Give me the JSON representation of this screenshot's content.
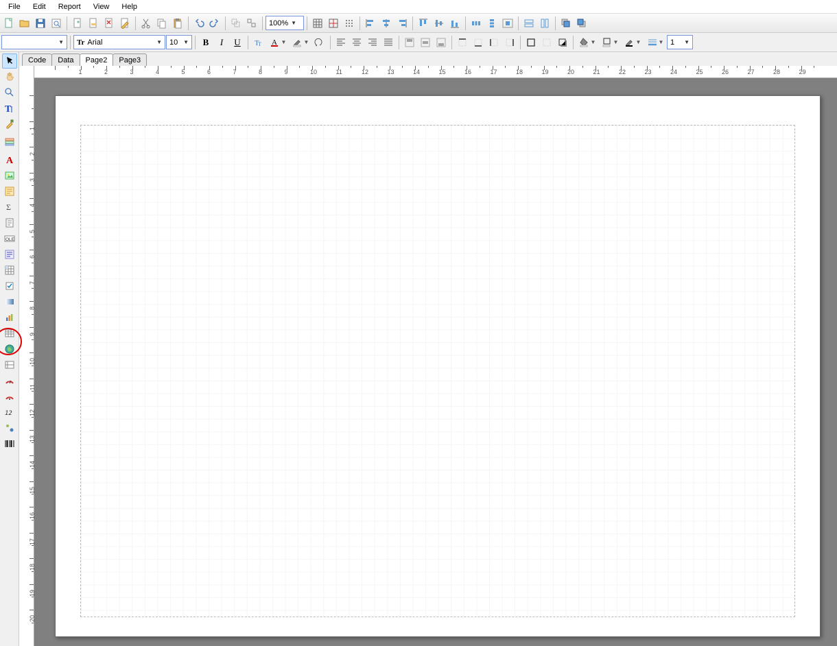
{
  "menus": [
    "File",
    "Edit",
    "Report",
    "View",
    "Help"
  ],
  "zoom": "100%",
  "style_combo": "",
  "font_name": "Arial",
  "font_size": "10",
  "fmt": {
    "b": "B",
    "i": "I",
    "u": "U"
  },
  "line_width": "1",
  "tabs": [
    "Code",
    "Data",
    "Page2",
    "Page3"
  ],
  "active_tab": 2,
  "hruler_max": 29,
  "vruler_max": 20
}
